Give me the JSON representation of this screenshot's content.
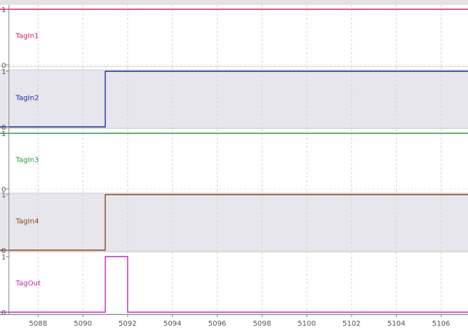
{
  "chart_data": {
    "type": "line",
    "step": true,
    "grid": true,
    "xlim": [
      5086.3,
      5107.2
    ],
    "x_ticks": [
      5088,
      5090,
      5092,
      5094,
      5096,
      5098,
      5100,
      5102,
      5104,
      5106
    ],
    "x_tick_labels": [
      "5088",
      "5090",
      "5092",
      "5094",
      "5096",
      "5098",
      "5100",
      "5102",
      "5104",
      "5106"
    ],
    "ylim": [
      0,
      1
    ],
    "y_tick_labels": [
      "0",
      "1"
    ],
    "series": [
      {
        "name": "TagIn1",
        "color": "#d0245e",
        "shaded": false,
        "points": [
          [
            5086.3,
            1
          ],
          [
            5107.2,
            1
          ]
        ]
      },
      {
        "name": "TagIn2",
        "color": "#1f2c9c",
        "shaded": true,
        "points": [
          [
            5086.3,
            0
          ],
          [
            5091,
            0
          ],
          [
            5091,
            1
          ],
          [
            5107.2,
            1
          ]
        ]
      },
      {
        "name": "TagIn3",
        "color": "#2b9a48",
        "shaded": false,
        "points": [
          [
            5086.3,
            1
          ],
          [
            5107.2,
            1
          ]
        ]
      },
      {
        "name": "TagIn4",
        "color": "#8a4a1a",
        "shaded": true,
        "points": [
          [
            5086.3,
            0
          ],
          [
            5091,
            0
          ],
          [
            5091,
            1
          ],
          [
            5107.2,
            1
          ]
        ]
      },
      {
        "name": "TagOut",
        "color": "#c42ab8",
        "shaded": false,
        "points": [
          [
            5086.3,
            0
          ],
          [
            5091,
            0
          ],
          [
            5091,
            1
          ],
          [
            5092,
            1
          ],
          [
            5092,
            0
          ],
          [
            5107.2,
            0
          ]
        ]
      }
    ]
  }
}
